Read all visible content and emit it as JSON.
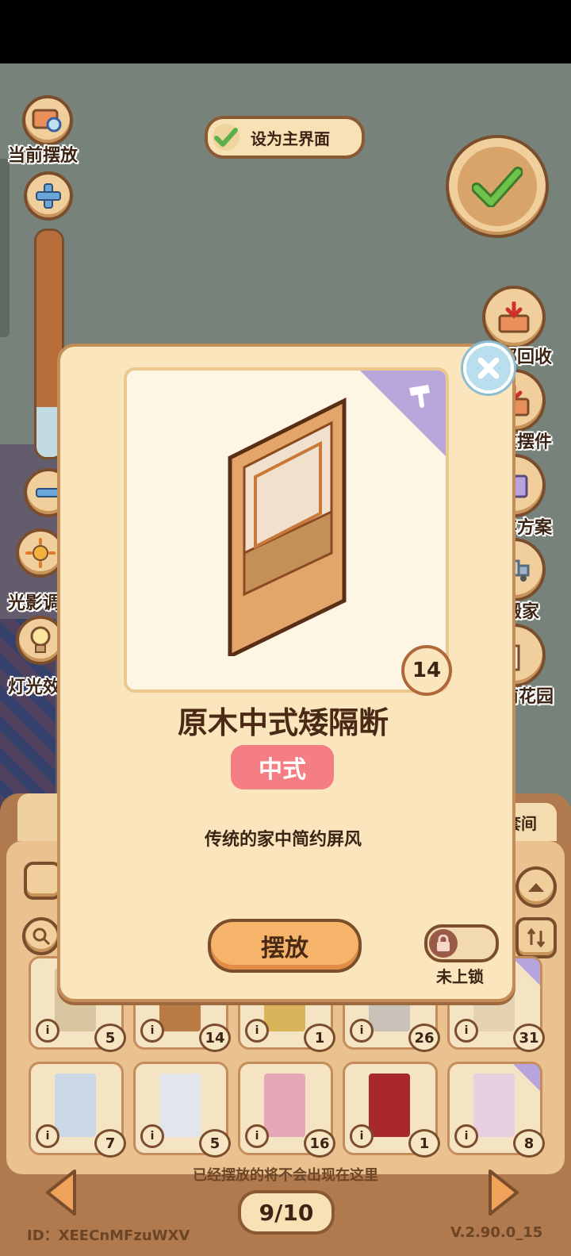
{
  "left_panel": {
    "current_placement_label": "当前摆放",
    "light_shadow_label": "光影调",
    "lighting_label": "灯光效"
  },
  "set_main": {
    "label": "设为主界面",
    "checked": true
  },
  "right_panel": {
    "recycle_label": "部回收",
    "pieces_label": "收摆件",
    "plan_label": "存方案",
    "move_label": "搬家",
    "garden_label": "前花园"
  },
  "slider": {
    "level": 0.78
  },
  "bottom": {
    "tab_suite": "套间",
    "notice": "已经摆放的将不会出现在这里",
    "page": "9/10",
    "user_id": "ID：XEECnMFzuWXV",
    "version": "V.2.90.0_15",
    "row1": [
      {
        "count": "5",
        "tag": false,
        "color": "#d9c6a0"
      },
      {
        "count": "14",
        "tag": false,
        "color": "#b97a44"
      },
      {
        "count": "1",
        "tag": false,
        "color": "#d9b45a"
      },
      {
        "count": "26",
        "tag": false,
        "color": "#c9c2b8"
      },
      {
        "count": "31",
        "tag": true,
        "color": "#e4d2b2"
      }
    ],
    "row2": [
      {
        "count": "7",
        "tag": false,
        "color": "#c9d8e4"
      },
      {
        "count": "5",
        "tag": false,
        "color": "#e2e6ec"
      },
      {
        "count": "16",
        "tag": false,
        "color": "#e7a7b8"
      },
      {
        "count": "1",
        "tag": false,
        "color": "#a8282e"
      },
      {
        "count": "8",
        "tag": true,
        "color": "#e8cfe0"
      }
    ]
  },
  "modal": {
    "count": "14",
    "name": "原木中式矮隔断",
    "style_tag": "中式",
    "description": "传统的家中简约屏风",
    "place_button": "摆放",
    "lock_label": "未上锁",
    "locked": false
  },
  "colors": {
    "tag_pink": "#f47e84",
    "accent_brown": "#7a4e2c",
    "corner_purple": "#b9a6db"
  }
}
